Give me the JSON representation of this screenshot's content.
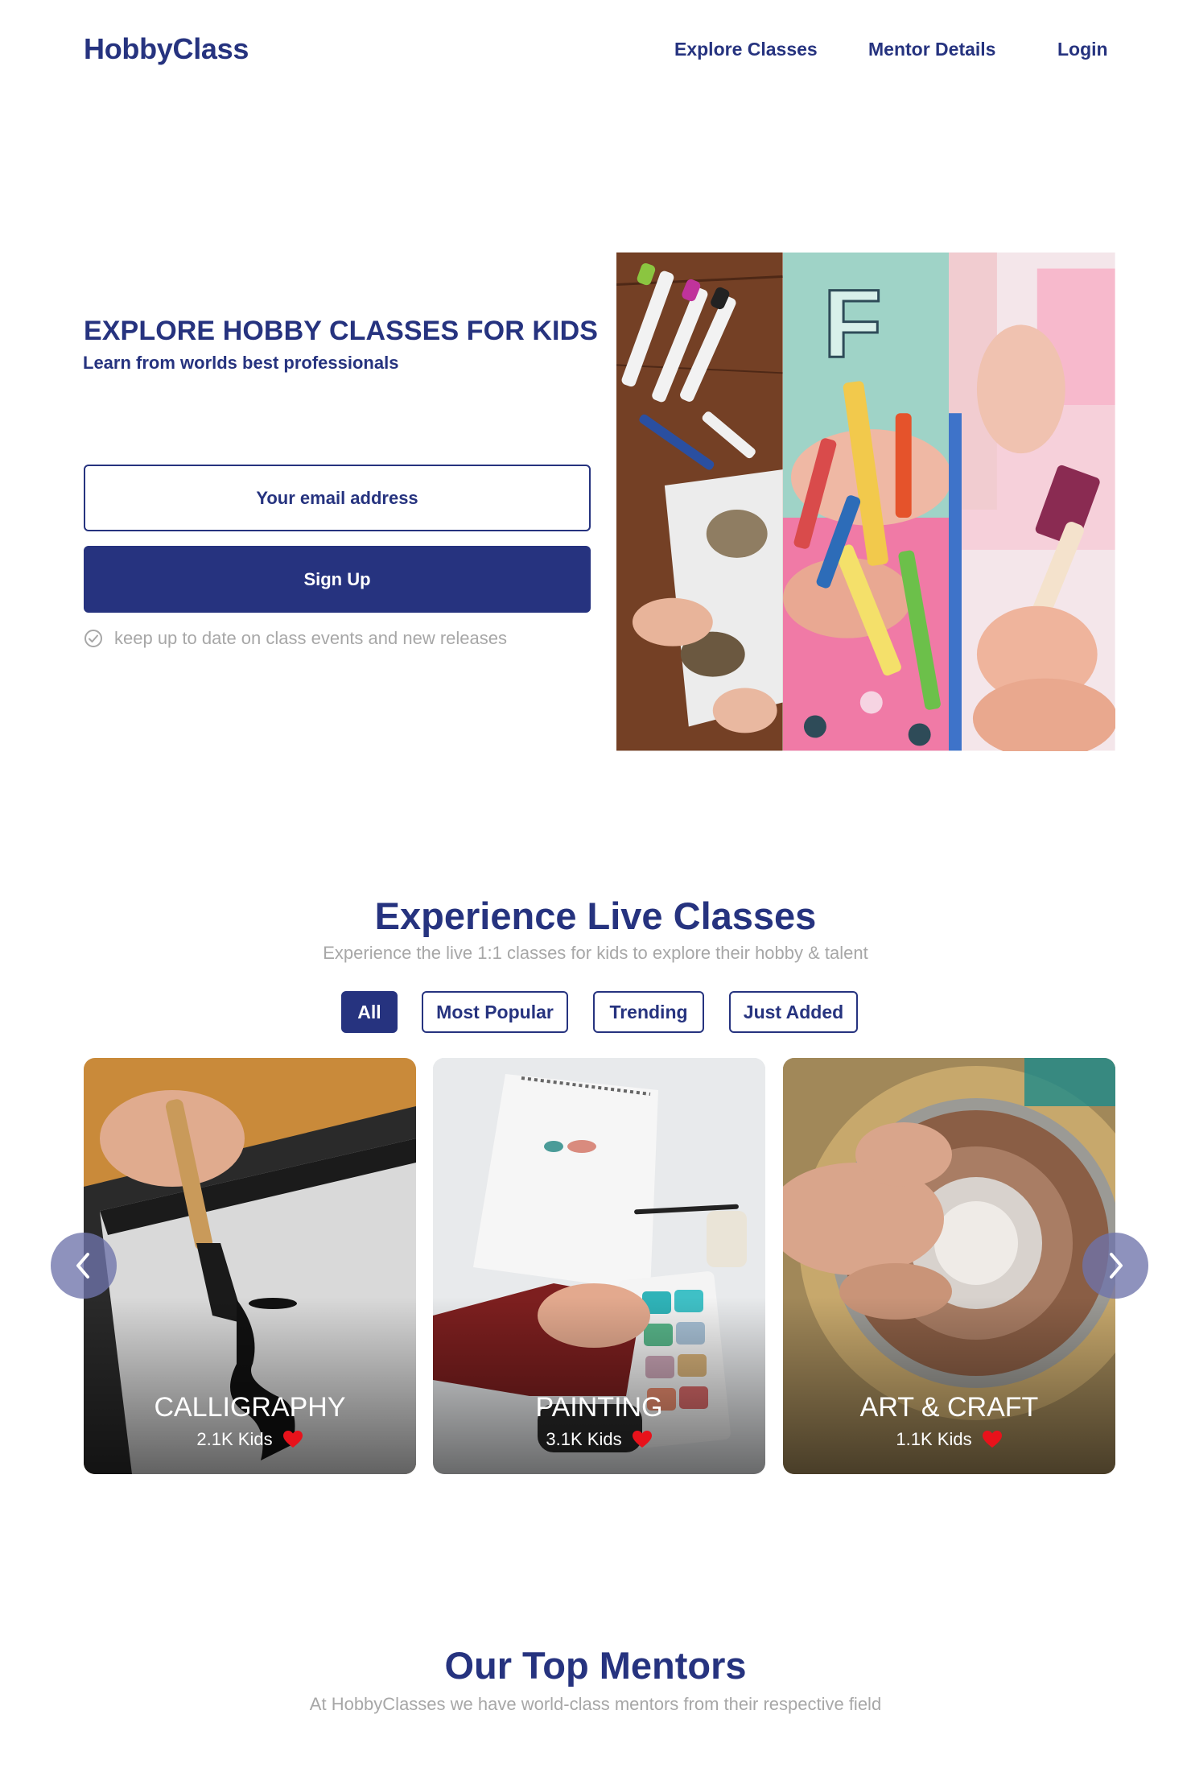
{
  "header": {
    "logo": "HobbyClass",
    "nav": {
      "explore": "Explore Classes",
      "mentor": "Mentor Details",
      "login": "Login"
    }
  },
  "hero": {
    "title": "EXPLORE HOBBY CLASSES FOR KIDS",
    "subtitle": "Learn from worlds best professionals",
    "email_placeholder": "Your email address",
    "email_value": "",
    "signup_label": "Sign Up",
    "note": "keep up to date on class events and new releases"
  },
  "live_classes": {
    "title": "Experience Live Classes",
    "subtitle": "Experience the live 1:1 classes for kids to explore their hobby & talent",
    "filters": [
      {
        "label": "All",
        "active": true
      },
      {
        "label": "Most Popular",
        "active": false
      },
      {
        "label": "Trending",
        "active": false
      },
      {
        "label": "Just Added",
        "active": false
      }
    ],
    "cards": [
      {
        "title": "CALLIGRAPHY",
        "kids": "2.1K Kids"
      },
      {
        "title": "PAINTING",
        "kids": "3.1K Kids"
      },
      {
        "title": "ART & CRAFT",
        "kids": "1.1K Kids"
      }
    ]
  },
  "mentors": {
    "title": "Our Top Mentors",
    "subtitle": "At HobbyClasses we have world-class mentors from their respective field"
  },
  "colors": {
    "brand": "#26337f",
    "muted_text": "#a7a7a7",
    "heart": "#e8121b",
    "arrow_bg": "#6e73aa"
  }
}
